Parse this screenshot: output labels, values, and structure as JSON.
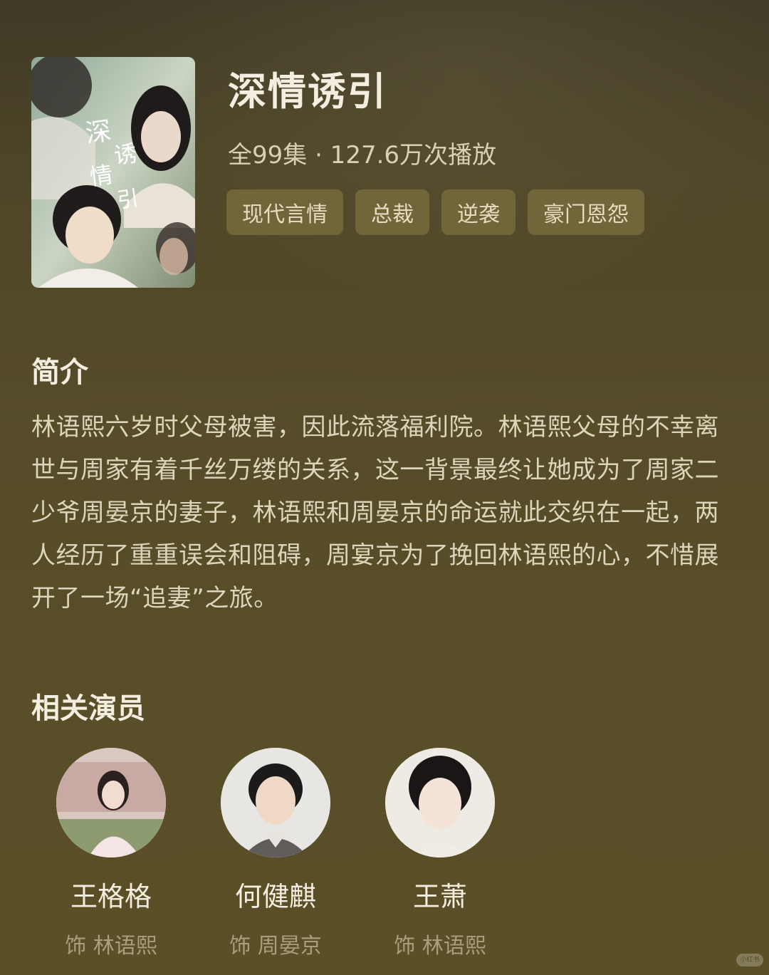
{
  "drama": {
    "title": "深情诱引",
    "meta": "全99集 · 127.6万次播放",
    "poster_text": "深情诱引",
    "tags": [
      "现代言情",
      "总裁",
      "逆袭",
      "豪门恩怨"
    ]
  },
  "intro": {
    "heading": "简介",
    "text": "林语熙六岁时父母被害，因此流落福利院。林语熙父母的不幸离世与周家有着千丝万缕的关系，这一背景最终让她成为了周家二少爷周晏京的妻子，林语熙和周晏京的命运就此交织在一起，两人经历了重重误会和阻碍，周宴京为了挽回林语熙的心，不惜展开了一场“追妻”之旅。"
  },
  "cast": {
    "heading": "相关演员",
    "actors": [
      {
        "name": "王格格",
        "role": "饰  林语熙"
      },
      {
        "name": "何健麒",
        "role": "饰  周晏京"
      },
      {
        "name": "王萧",
        "role": "饰  林语熙"
      }
    ]
  },
  "watermark": "小红书"
}
